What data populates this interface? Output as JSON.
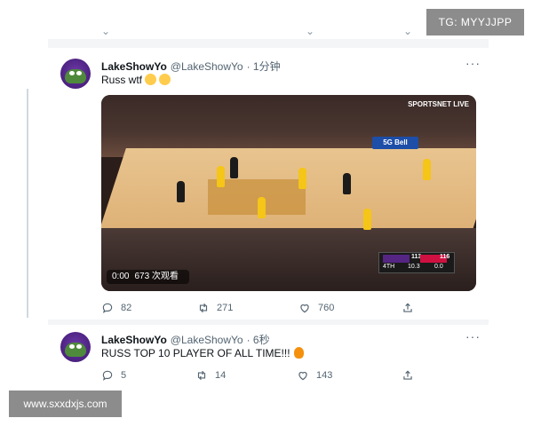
{
  "watermarks": {
    "top_right": "TG: MYYJJPP",
    "bottom_left": "www.sxxdxjs.com"
  },
  "tweets": [
    {
      "author_name": "LakeShowYo",
      "handle": "@LakeShowYo",
      "time": "· 1分钟",
      "text": "Russ wtf",
      "emojis": [
        "crying-face",
        "crying-face"
      ],
      "video": {
        "time": "0:00",
        "views": "673 次观看",
        "broadcast": "SPORTSNET LIVE",
        "sponsor": "5G Bell",
        "scorebug": {
          "home_score": "113",
          "away_score": "116",
          "quarter": "4TH",
          "clock": "10.3",
          "shot": "0.0"
        }
      },
      "stats": {
        "replies": "82",
        "retweets": "271",
        "likes": "760"
      }
    },
    {
      "author_name": "LakeShowYo",
      "handle": "@LakeShowYo",
      "time": "· 6秒",
      "text": "RUSS TOP 10 PLAYER OF ALL TIME!!!",
      "emojis": [
        "fire"
      ],
      "stats": {
        "replies": "5",
        "retweets": "14",
        "likes": "143"
      }
    }
  ],
  "icons": {
    "reply": "reply-icon",
    "retweet": "retweet-icon",
    "like": "heart-icon",
    "share": "share-icon",
    "more": "more-icon"
  },
  "colors": {
    "text_primary": "#0f1419",
    "text_secondary": "#536471",
    "watermark_bg": "#8c8c8c"
  }
}
